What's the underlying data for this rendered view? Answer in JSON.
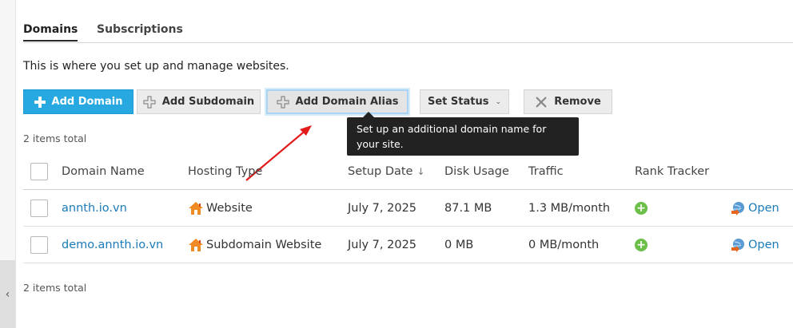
{
  "tabs": [
    {
      "label": "Domains",
      "active": true
    },
    {
      "label": "Subscriptions",
      "active": false
    }
  ],
  "description": "This is where you set up and manage websites.",
  "toolbar": {
    "add_domain": "Add Domain",
    "add_subdomain": "Add Subdomain",
    "add_domain_alias": "Add Domain Alias",
    "set_status": "Set Status",
    "remove": "Remove"
  },
  "tooltip": "Set up an additional domain name for your site.",
  "items_total_top": "2 items total",
  "items_total_bottom": "2 items total",
  "table": {
    "headers": {
      "domain_name": "Domain Name",
      "hosting_type": "Hosting Type",
      "setup_date": "Setup Date",
      "disk_usage": "Disk Usage",
      "traffic": "Traffic",
      "rank_tracker": "Rank Tracker"
    },
    "sort_indicator": "↓",
    "rows": [
      {
        "domain": "annth.io.vn",
        "hosting_type": "Website",
        "setup_date": "July 7, 2025",
        "disk_usage": "87.1 MB",
        "traffic": "1.3 MB/month",
        "open": "Open"
      },
      {
        "domain": "demo.annth.io.vn",
        "hosting_type": "Subdomain Website",
        "setup_date": "July 7, 2025",
        "disk_usage": "0 MB",
        "traffic": "0 MB/month",
        "open": "Open"
      }
    ]
  },
  "colors": {
    "primary_button": "#28a8e0",
    "link": "#1a7bb9",
    "annotation_arrow": "#e21b1b",
    "rank_plus": "#6cc04a"
  },
  "icons": {
    "add_domain": "plus-icon",
    "add_subdomain": "plus-outline-icon",
    "add_alias": "plus-outline-icon",
    "remove": "x-icon",
    "hosting": "house-icon",
    "open": "globe-arrow-icon",
    "rank": "plus-circle-icon",
    "collapse": "chevron-left-icon"
  }
}
